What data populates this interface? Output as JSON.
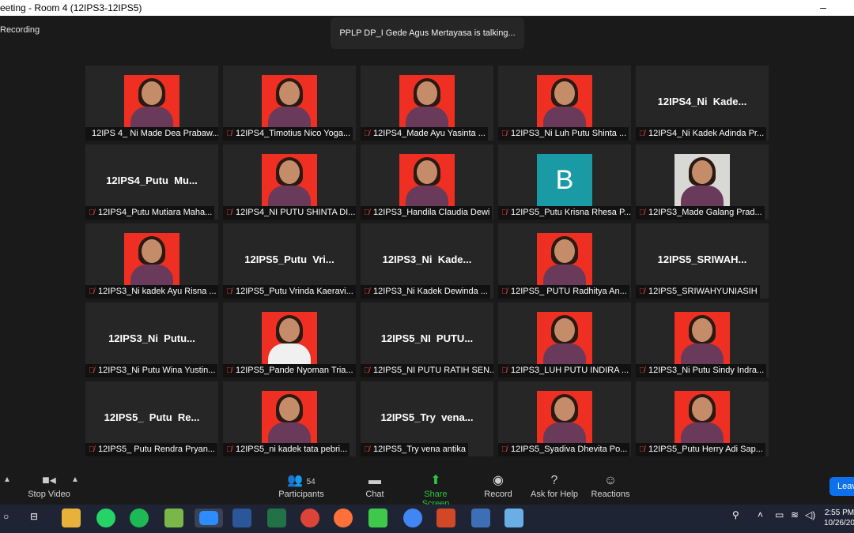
{
  "window": {
    "title": "eeting - Room 4 (12IPS3-12IPS5)"
  },
  "recording": "Recording",
  "talking": "PPLP DP_I Gede Agus Mertayasa is talking...",
  "tiles": [
    {
      "name": "12IPS 4_ Ni Made Dea Prabaw...",
      "video": true
    },
    {
      "name": "12IPS4_Timotius Nico Yoga...",
      "video": true
    },
    {
      "name": "12IPS4_Made Ayu Yasinta ...",
      "video": true
    },
    {
      "name": "12IPS3_Ni Luh Putu Shinta ...",
      "video": true
    },
    {
      "name": "12IPS4_Ni Kadek Adinda Pr...",
      "bigname": "12IPS4_Ni  Kade..."
    },
    {
      "name": "12IPS4_Putu Mutiara Maha...",
      "bigname": "12IPS4_Putu  Mu..."
    },
    {
      "name": "12IPS4_NI PUTU SHINTA DI...",
      "video": true
    },
    {
      "name": "12IPS3_Handila Claudia Dewi",
      "video": true
    },
    {
      "name": "12IPS5_Putu Krisna Rhesa P...",
      "avatar": "B"
    },
    {
      "name": "12IPS3_Made Galang Prad...",
      "video": true
    },
    {
      "name": "12IPS3_Ni kadek Ayu Risna ...",
      "video": true
    },
    {
      "name": "12IPS5_Putu Vrinda Kaeravi...",
      "bigname": "12IPS5_Putu  Vri..."
    },
    {
      "name": "12IPS3_Ni Kadek Dewinda ...",
      "bigname": "12IPS3_Ni  Kade..."
    },
    {
      "name": "12IPS5_ PUTU Radhitya An...",
      "video": true
    },
    {
      "name": "12IPS5_SRIWAHYUNIASIH",
      "bigname": "12IPS5_SRIWAH..."
    },
    {
      "name": "12IPS3_Ni Putu Wina Yustin...",
      "bigname": "12IPS3_Ni  Putu..."
    },
    {
      "name": "12IPS5_Pande Nyoman Tria...",
      "video": true
    },
    {
      "name": "12IPS5_NI PUTU RATIH SEN...",
      "bigname": "12IPS5_NI  PUTU..."
    },
    {
      "name": "12IPS3_LUH PUTU INDIRA ...",
      "video": true
    },
    {
      "name": "12IPS3_Ni Putu Sindy Indra...",
      "video": true
    },
    {
      "name": "12IPS5_ Putu Rendra Pryan...",
      "bigname": "12IPS5_  Putu  Re..."
    },
    {
      "name": "12IPS5_ni kadek tata pebri...",
      "video": true
    },
    {
      "name": "12IPS5_Try vena antika",
      "bigname": "12IPS5_Try  vena..."
    },
    {
      "name": "12IPS5_Syadiva Dhevita Po...",
      "video": true
    },
    {
      "name": "12IPS5_Putu Herry Adi Sap...",
      "video": true
    }
  ],
  "toolbar": {
    "stop_video": "Stop Video",
    "participants": "Participants",
    "participants_count": "54",
    "chat": "Chat",
    "share_screen": "Share Screen",
    "record": "Record",
    "ask_for_help": "Ask for Help",
    "reactions": "Reactions",
    "leave": "Leav"
  },
  "clock": {
    "time": "2:55 PM",
    "date": "10/26/20"
  }
}
